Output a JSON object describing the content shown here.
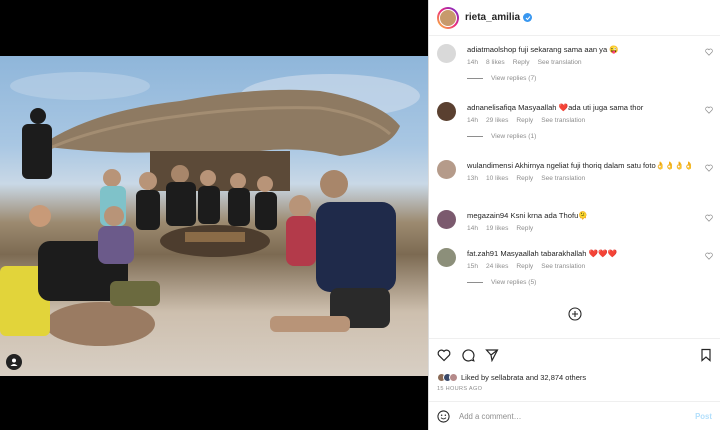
{
  "post": {
    "owner": "rieta_amilia",
    "verified": true
  },
  "comments": [
    {
      "user": "adiatmaolshop",
      "text": "fuji sekarang sama aan ya 😜",
      "time": "14h",
      "likes": "8 likes",
      "reply": "Reply",
      "translate": "See translation",
      "view_replies": "View replies (7)",
      "avatar_color": "#d9d9d9"
    },
    {
      "user": "adnanelisafiqa",
      "text": "Masyaallah ❤️ada uti juga sama thor",
      "time": "14h",
      "likes": "29 likes",
      "reply": "Reply",
      "translate": "See translation",
      "view_replies": "View replies (1)",
      "avatar_color": "#5a4030"
    },
    {
      "user": "wulandimensi",
      "text": "Akhirnya ngeliat fuji thoriq dalam satu foto👌👌👌👌",
      "time": "13h",
      "likes": "10 likes",
      "reply": "Reply",
      "translate": "See translation",
      "view_replies": "",
      "avatar_color": "#b59b8a"
    },
    {
      "user": "megazain94",
      "text": "Ksni krna ada Thofu🫠",
      "time": "14h",
      "likes": "19 likes",
      "reply": "Reply",
      "translate": "",
      "view_replies": "",
      "avatar_color": "#7b5a6e"
    },
    {
      "user": "fat.zah91",
      "text": "Masyaallah tabarakhallah ❤️❤️❤️",
      "time": "15h",
      "likes": "24 likes",
      "reply": "Reply",
      "translate": "See translation",
      "view_replies": "View replies (5)",
      "avatar_color": "#8c8f7a"
    }
  ],
  "actions": {
    "liked_by_prefix": "Liked by",
    "liked_by_user": "sellabrata",
    "liked_by_and": "and",
    "liked_by_count": "32,874 others",
    "time_ago": "15 HOURS AGO",
    "comment_placeholder": "Add a comment…",
    "post_label": "Post"
  },
  "icons": {
    "heart": "heart-icon",
    "comment": "comment-icon",
    "share": "share-icon",
    "save": "bookmark-icon",
    "emoji": "emoji-icon",
    "more": "plus-circle-icon",
    "tagged_users": "user-tag-icon"
  },
  "colors": {
    "verified": "#3897f0",
    "post_button_disabled": "#b2dffc",
    "heart_red": "#ed4956"
  }
}
